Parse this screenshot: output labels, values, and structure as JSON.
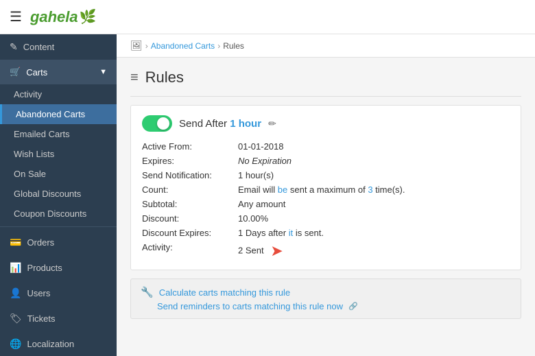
{
  "header": {
    "logo_text": "gahela",
    "logo_leaf": "✿"
  },
  "sidebar": {
    "items": [
      {
        "id": "content",
        "label": "Content",
        "icon": "✎"
      },
      {
        "id": "carts",
        "label": "Carts",
        "icon": "🛒",
        "expanded": true
      },
      {
        "id": "orders",
        "label": "Orders",
        "icon": "💳"
      },
      {
        "id": "products",
        "label": "Products",
        "icon": "📊"
      },
      {
        "id": "users",
        "label": "Users",
        "icon": "👤"
      },
      {
        "id": "tickets",
        "label": "Tickets",
        "icon": "🏷"
      },
      {
        "id": "localization",
        "label": "Localization",
        "icon": "🌐"
      }
    ],
    "carts_sub": [
      {
        "id": "activity",
        "label": "Activity",
        "active": false
      },
      {
        "id": "abandoned-carts",
        "label": "Abandoned Carts",
        "active": true
      },
      {
        "id": "emailed-carts",
        "label": "Emailed Carts",
        "active": false
      },
      {
        "id": "wish-lists",
        "label": "Wish Lists",
        "active": false
      },
      {
        "id": "on-sale",
        "label": "On Sale",
        "active": false
      },
      {
        "id": "global-discounts",
        "label": "Global Discounts",
        "active": false
      },
      {
        "id": "coupon-discounts",
        "label": "Coupon Discounts",
        "active": false
      }
    ]
  },
  "breadcrumb": {
    "icon": "🖼",
    "home_link": "Abandoned Carts",
    "separator": ">",
    "current": "Rules"
  },
  "page": {
    "title": "Rules",
    "title_icon": "≡"
  },
  "rule": {
    "toggle_on": true,
    "send_after_label": "Send After",
    "send_after_value": "1 hour",
    "edit_icon": "✏",
    "fields": [
      {
        "label": "Active From:",
        "value": "01-01-2018",
        "type": "plain"
      },
      {
        "label": "Expires:",
        "value": "No Expiration",
        "type": "italic"
      },
      {
        "label": "Send Notification:",
        "value": "1 hour(s)",
        "type": "blue"
      },
      {
        "label": "Count:",
        "value": "Email will be sent a maximum of 3 time(s).",
        "type": "blue-partial"
      },
      {
        "label": "Subtotal:",
        "value": "Any amount",
        "type": "plain"
      },
      {
        "label": "Discount:",
        "value": "10.00%",
        "type": "plain"
      },
      {
        "label": "Discount Expires:",
        "value": "1 Days after it is sent.",
        "type": "blue-partial2"
      },
      {
        "label": "Activity:",
        "value": "2 Sent",
        "type": "arrow"
      }
    ],
    "actions": [
      {
        "id": "calculate",
        "icon": "🔧",
        "label": "Calculate carts matching this rule",
        "external": false
      },
      {
        "id": "send-reminders",
        "icon": "",
        "label": "Send reminders to carts matching this rule now",
        "external": true
      }
    ]
  }
}
